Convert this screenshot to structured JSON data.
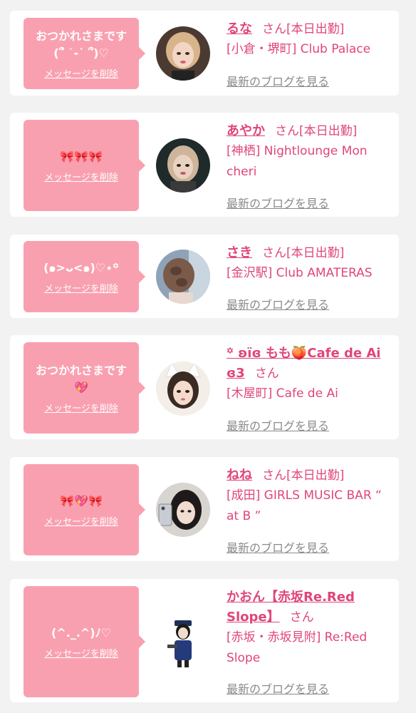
{
  "colors": {
    "background": "#f2f2f2",
    "card": "#ffffff",
    "bubble": "#f9a0b0",
    "accent_pink": "#e0457b",
    "link_gray": "#8a8a8a"
  },
  "common": {
    "delete_label": "メッセージを削除",
    "blog_label": "最新のブログを見る",
    "san_label": "さん"
  },
  "cards": [
    {
      "message": "おつかれさまです\n(՞ ˙-˙ ՞)♡",
      "name": "るな",
      "status": "[本日出勤]",
      "shop": "[小倉・堺町] Club Palace",
      "avatar_icon": "woman-blonde-portrait"
    },
    {
      "message": "🎀🎀🎀",
      "name": "あやか",
      "status": "[本日出勤]",
      "shop": "[神栖] Nightlounge Mon cheri",
      "avatar_icon": "woman-dark-portrait"
    },
    {
      "message": "(๑>ᴗ<๑)♡⋆꙳",
      "name": "さき",
      "status": "[本日出勤]",
      "shop": "[金沢駅] Club AMATERAS",
      "avatar_icon": "woman-braided-hair-portrait"
    },
    {
      "message": "おつかれさまです\n💖",
      "name": "꙳ ʚїɞ もも🍑Cafe de Ai ɞ3",
      "status": "",
      "shop": "[木屋町] Cafe de Ai",
      "avatar_icon": "woman-cat-ears-portrait"
    },
    {
      "message": "🎀💖🎀",
      "name": "ねね",
      "status": "[本日出勤]",
      "shop": "[成田] GIRLS MUSIC BAR “ at B ”",
      "avatar_icon": "woman-phone-selfie-portrait"
    },
    {
      "message": "(^._.^)ﾉ♡",
      "name": "かおん【赤坂Re.Red Slope】",
      "status": "",
      "shop": "[赤坂・赤坂見附] Re:Red Slope",
      "avatar_icon": "police-costume-figure"
    }
  ]
}
